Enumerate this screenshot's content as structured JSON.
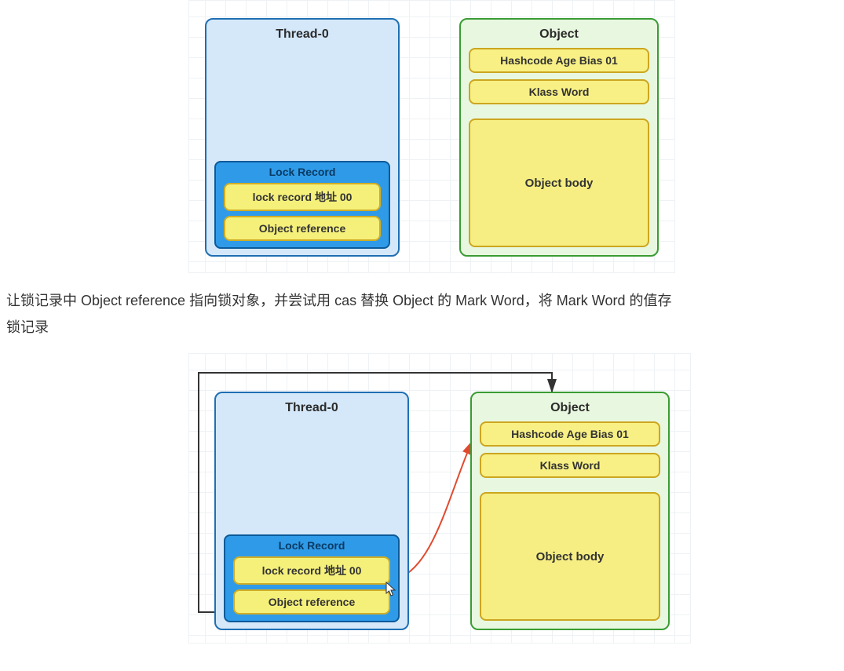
{
  "diagram_top": {
    "thread": {
      "title": "Thread-0",
      "lock_record": {
        "title": "Lock Record",
        "row1": "lock record 地址 00",
        "row2": "Object reference"
      }
    },
    "object": {
      "title": "Object",
      "field1": "Hashcode Age Bias 01",
      "field2": "Klass Word",
      "body": "Object body"
    }
  },
  "paragraph": {
    "line1": "让锁记录中 Object reference 指向锁对象，并尝试用 cas 替换 Object 的 Mark Word，将 Mark Word 的值存",
    "line2": "锁记录"
  },
  "diagram_bottom": {
    "thread": {
      "title": "Thread-0",
      "lock_record": {
        "title": "Lock Record",
        "row1": "lock record 地址 00",
        "row2": "Object reference"
      }
    },
    "object": {
      "title": "Object",
      "field1": "Hashcode Age Bias 01",
      "field2": "Klass Word",
      "body": "Object body"
    }
  }
}
